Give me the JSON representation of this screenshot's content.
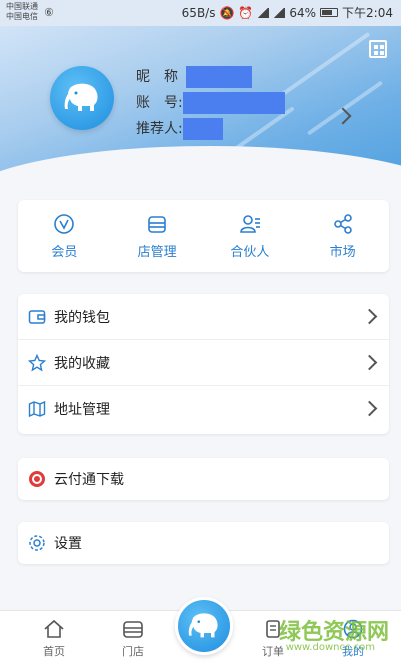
{
  "status_bar": {
    "carrier1": "中国联通",
    "carrier2": "中国电信",
    "speed": "65B/s",
    "battery": "64%",
    "time": "下午2:04"
  },
  "profile": {
    "nickname_label": "昵　称",
    "account_label": "账　号:",
    "referrer_label": "推荐人:"
  },
  "shortcuts": [
    {
      "label": "会员",
      "icon": "vip-icon"
    },
    {
      "label": "店管理",
      "icon": "store-icon"
    },
    {
      "label": "合伙人",
      "icon": "partner-icon"
    },
    {
      "label": "市场",
      "icon": "share-icon"
    }
  ],
  "menu": {
    "wallet": "我的钱包",
    "favorites": "我的收藏",
    "address": "地址管理",
    "download": "云付通下载",
    "settings": "设置"
  },
  "bottom_nav": {
    "home": "首页",
    "store": "门店",
    "orders": "订单",
    "mine": "我的"
  },
  "watermark": {
    "title": "绿色资源网",
    "url": "www.downcc.com"
  },
  "colors": {
    "accent": "#2a7fd0",
    "mask": "#4b7fef",
    "badge": "#f6a623"
  }
}
